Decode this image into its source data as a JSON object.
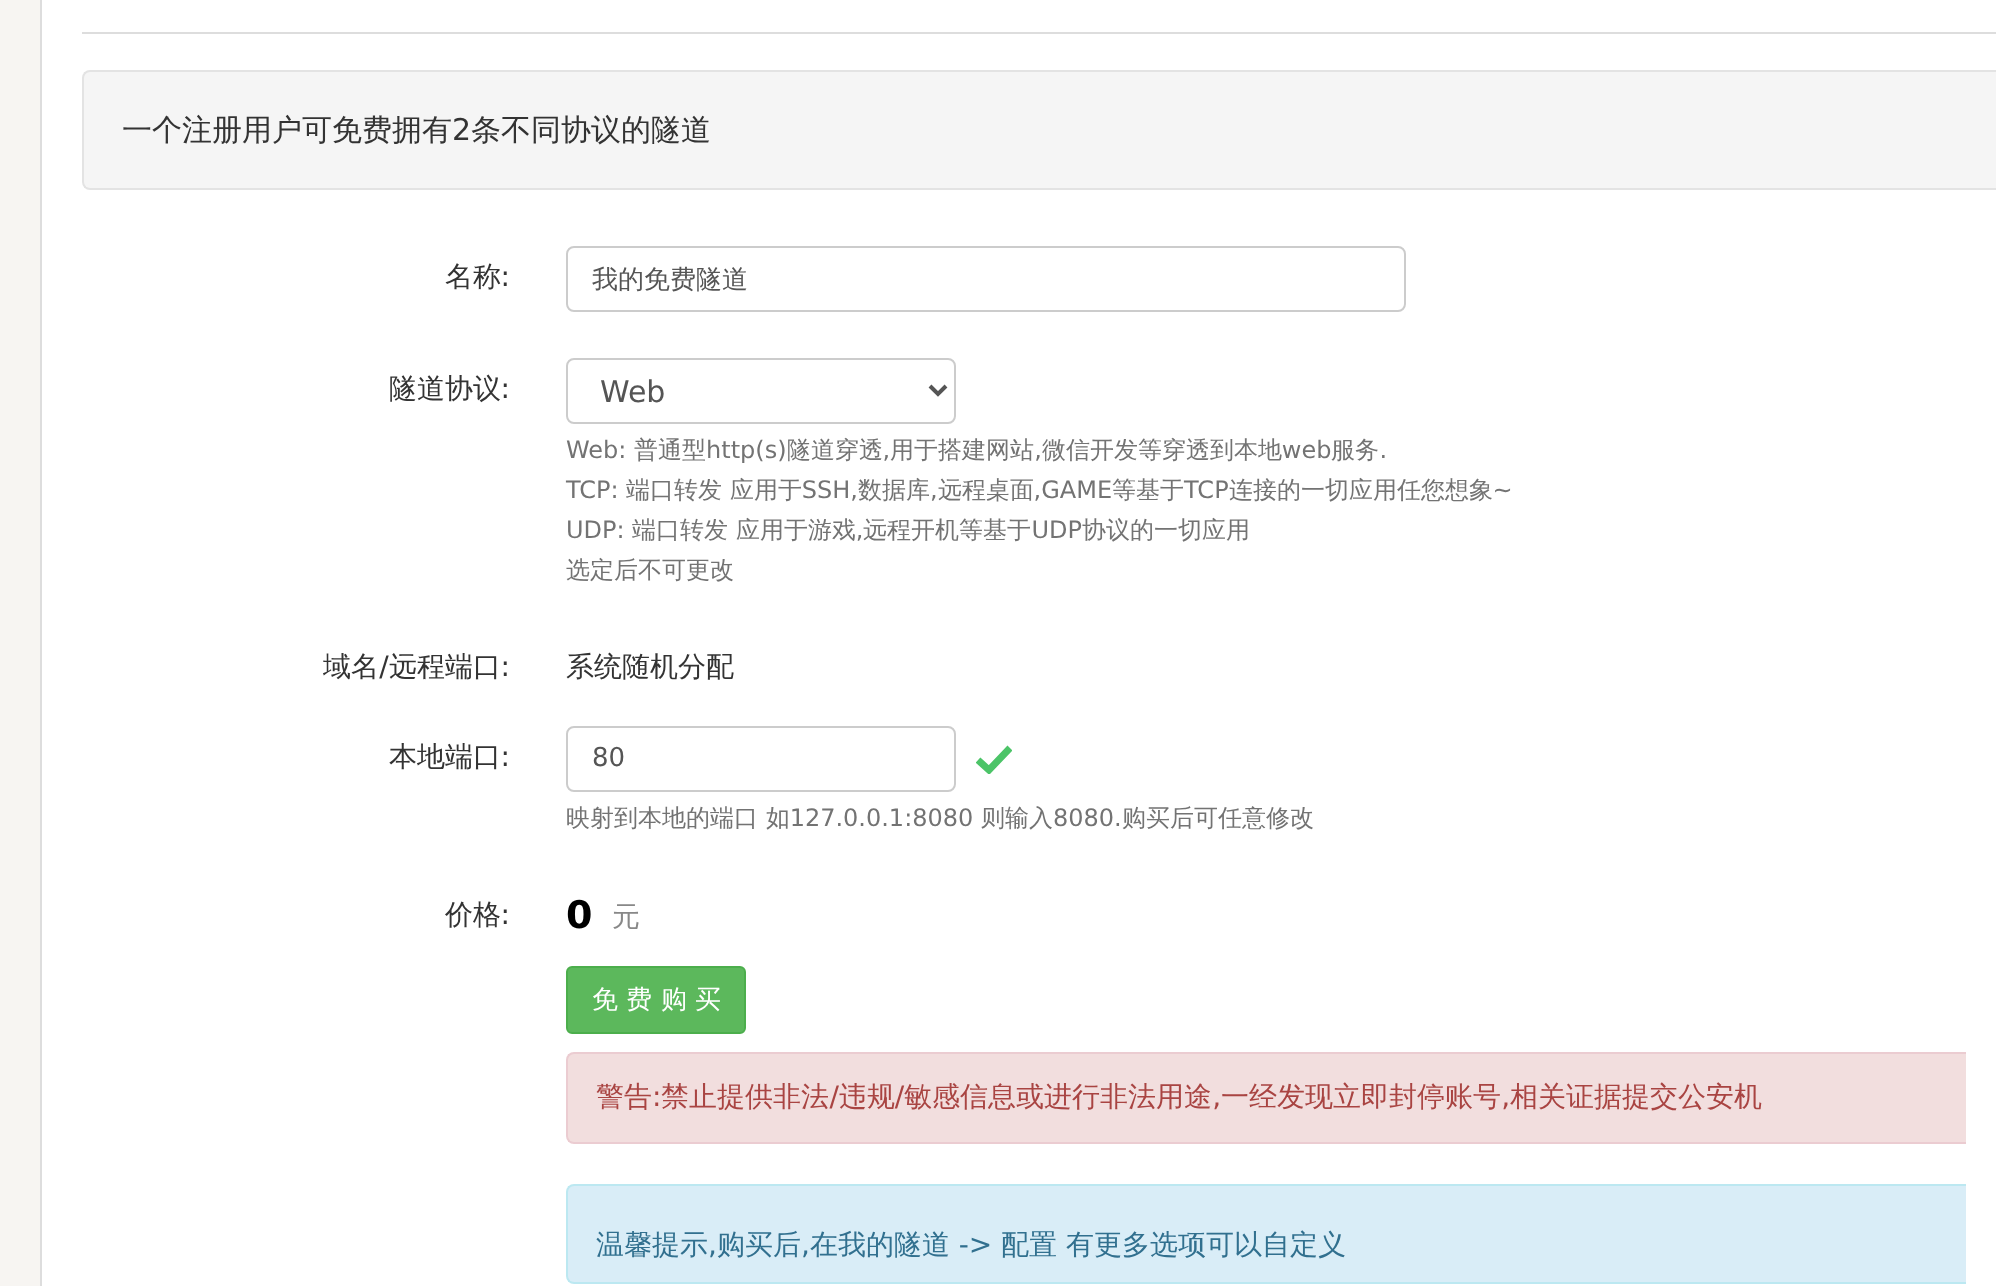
{
  "notice": "一个注册用户可免费拥有2条不同协议的隧道",
  "form": [
    {
      "kind": "input",
      "label": "名称:",
      "value": "我的免费隧道",
      "wide": true
    },
    {
      "kind": "select",
      "label": "隧道协议:",
      "value": "Web",
      "help": [
        "Web: 普通型http(s)隧道穿透,用于搭建网站,微信开发等穿透到本地web服务.",
        "TCP: 端口转发 应用于SSH,数据库,远程桌面,GAME等基于TCP连接的一切应用任您想象~",
        "UDP: 端口转发 应用于游戏,远程开机等基于UDP协议的一切应用",
        "选定后不可更改"
      ]
    },
    {
      "kind": "text",
      "label": "域名/远程端口:",
      "value": "系统随机分配"
    },
    {
      "kind": "input",
      "label": "本地端口:",
      "value": "80",
      "wide": false,
      "valid": true,
      "help": [
        "映射到本地的端口 如127.0.0.1:8080 则输入8080.购买后可任意修改"
      ]
    },
    {
      "kind": "price",
      "label": "价格:",
      "value": "0",
      "unit": "元"
    }
  ],
  "buy_button": "免 费 购 买",
  "alerts": [
    {
      "kind": "danger",
      "text": "警告:禁止提供非法/违规/敏感信息或进行非法用途,一经发现立即封停账号,相关证据提交公安机"
    },
    {
      "kind": "info",
      "text": "温馨提示,购买后,在我的隧道 -> 配置 有更多选项可以自定义"
    }
  ]
}
